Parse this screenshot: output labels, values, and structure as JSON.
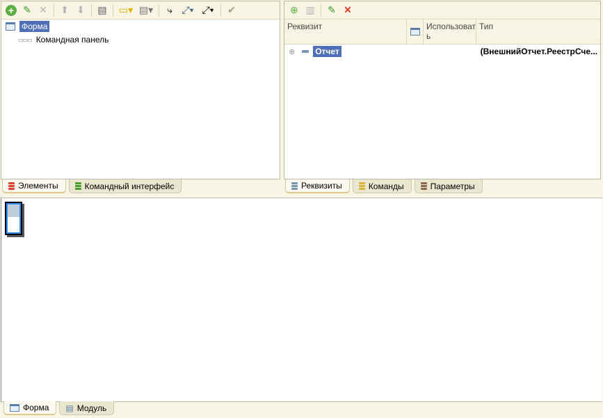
{
  "left_panel": {
    "toolbar": [
      "add-icon",
      "edit-icon",
      "delete-icon",
      "move-up-icon",
      "move-down-icon",
      "list-icon",
      "display-dropdown-icon",
      "layout-dropdown-icon",
      "swap-icon",
      "resize-dropdown-icon",
      "expand-dropdown-icon",
      "check-icon"
    ],
    "tree": [
      {
        "label": "Форма",
        "selected": true
      },
      {
        "label": "Командная панель"
      }
    ],
    "tabs": [
      {
        "label": "Элементы",
        "active": true,
        "color": "#e0412e"
      },
      {
        "label": "Командный интерфейс",
        "color": "#4a9e2e"
      }
    ]
  },
  "right_panel": {
    "columns": [
      "Реквизит",
      "Использоват ь",
      "Тип"
    ],
    "rows": [
      {
        "name": "Отчет",
        "type": "(ВнешнийОтчет.РеестрСче..."
      }
    ],
    "tabs": [
      {
        "label": "Реквизиты",
        "active": true,
        "color": "#7896b4"
      },
      {
        "label": "Команды",
        "color": "#d9b53a"
      },
      {
        "label": "Параметры",
        "color": "#8b6a4e"
      }
    ]
  },
  "bottom_tabs": [
    {
      "label": "Форма",
      "active": true
    },
    {
      "label": "Модуль"
    }
  ]
}
